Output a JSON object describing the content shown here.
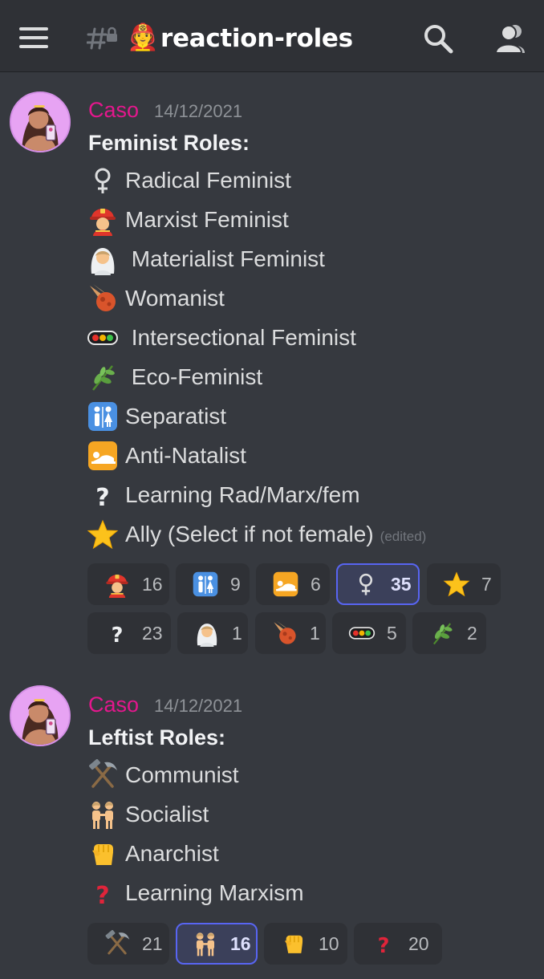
{
  "header": {
    "channel_emoji": "🧑‍🚒",
    "channel_name": "reaction-roles"
  },
  "messages": [
    {
      "author": "Caso",
      "timestamp": "14/12/2021",
      "heading": "Feminist Roles:",
      "lines": [
        {
          "icon": "female-sign-icon",
          "text": "Radical Feminist"
        },
        {
          "icon": "firefighter-woman-icon",
          "text": "Marxist Feminist"
        },
        {
          "icon": "bride-veil-icon",
          "text": " Materialist Feminist"
        },
        {
          "icon": "meteor-icon",
          "text": "Womanist"
        },
        {
          "icon": "traffic-light-icon",
          "text": " Intersectional Feminist"
        },
        {
          "icon": "herb-icon",
          "text": " Eco-Feminist"
        },
        {
          "icon": "restroom-icon",
          "text": "Separatist"
        },
        {
          "icon": "bed-sleeping-icon",
          "text": "Anti-Natalist"
        },
        {
          "icon": "white-question-icon",
          "text": "Learning Rad/Marx/fem"
        },
        {
          "icon": "star-icon",
          "text": "Ally (Select if not female)",
          "edited": "(edited)"
        }
      ],
      "reactions": [
        {
          "icon": "firefighter-woman-icon",
          "count": "16",
          "active": false
        },
        {
          "icon": "restroom-icon",
          "count": "9",
          "active": false
        },
        {
          "icon": "bed-sleeping-icon",
          "count": "6",
          "active": false
        },
        {
          "icon": "female-sign-icon",
          "count": "35",
          "active": true
        },
        {
          "icon": "star-icon",
          "count": "7",
          "active": false
        },
        {
          "icon": "white-question-icon",
          "count": "23",
          "active": false
        },
        {
          "icon": "bride-veil-icon",
          "count": "1",
          "active": false
        },
        {
          "icon": "meteor-icon",
          "count": "1",
          "active": false
        },
        {
          "icon": "traffic-light-icon",
          "count": "5",
          "active": false
        },
        {
          "icon": "herb-icon",
          "count": "2",
          "active": false
        }
      ]
    },
    {
      "author": "Caso",
      "timestamp": "14/12/2021",
      "heading": "Leftist Roles:",
      "lines": [
        {
          "icon": "hammer-pick-icon",
          "text": "Communist"
        },
        {
          "icon": "two-people-icon",
          "text": "Socialist"
        },
        {
          "icon": "raised-fist-icon",
          "text": "Anarchist"
        },
        {
          "icon": "red-question-icon",
          "text": "Learning Marxism"
        }
      ],
      "reactions": [
        {
          "icon": "hammer-pick-icon",
          "count": "21",
          "active": false
        },
        {
          "icon": "two-people-icon",
          "count": "16",
          "active": true
        },
        {
          "icon": "raised-fist-icon",
          "count": "10",
          "active": false
        },
        {
          "icon": "red-question-icon",
          "count": "20",
          "active": false
        }
      ]
    }
  ],
  "colors": {
    "background": "#36393f",
    "header": "#2f3136",
    "author": "#e4178d",
    "reaction_active_border": "#5865f2"
  }
}
